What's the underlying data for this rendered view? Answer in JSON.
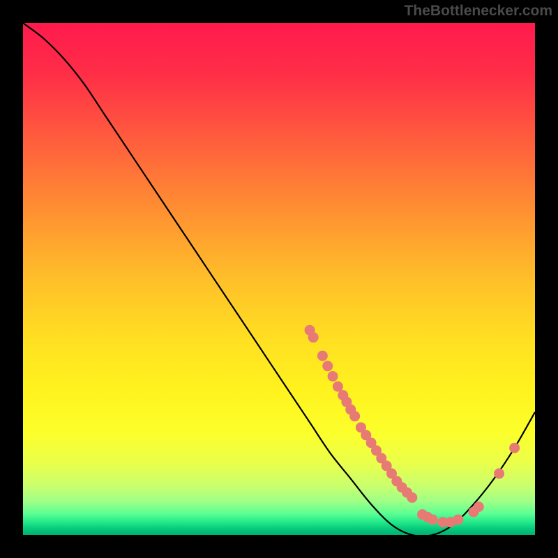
{
  "attribution": "TheBottlenecker.com",
  "chart_data": {
    "type": "line",
    "title": "",
    "xlabel": "",
    "ylabel": "",
    "xlim": [
      0,
      100
    ],
    "ylim": [
      0,
      100
    ],
    "series": [
      {
        "name": "curve",
        "x": [
          0,
          4,
          8,
          12,
          16,
          20,
          24,
          28,
          32,
          36,
          40,
          44,
          48,
          52,
          56,
          60,
          64,
          68,
          72,
          76,
          80,
          84,
          88,
          92,
          96,
          100
        ],
        "y": [
          100,
          97,
          93,
          88,
          82,
          76,
          70,
          64,
          58,
          52,
          46,
          40,
          34,
          28,
          22,
          16,
          11,
          6,
          2,
          0,
          0,
          2,
          6,
          11,
          17,
          24
        ]
      }
    ],
    "scatter_points": [
      {
        "x": 56,
        "y": 40
      },
      {
        "x": 56.7,
        "y": 38.6
      },
      {
        "x": 58.5,
        "y": 35
      },
      {
        "x": 59.5,
        "y": 33
      },
      {
        "x": 60.5,
        "y": 31
      },
      {
        "x": 61.5,
        "y": 29
      },
      {
        "x": 62.5,
        "y": 27.3
      },
      {
        "x": 63.2,
        "y": 26
      },
      {
        "x": 64,
        "y": 24.5
      },
      {
        "x": 64.8,
        "y": 23.2
      },
      {
        "x": 66,
        "y": 21
      },
      {
        "x": 67,
        "y": 19.5
      },
      {
        "x": 68,
        "y": 18
      },
      {
        "x": 69,
        "y": 16.5
      },
      {
        "x": 70,
        "y": 15
      },
      {
        "x": 71,
        "y": 13.5
      },
      {
        "x": 72,
        "y": 12
      },
      {
        "x": 73,
        "y": 10.5
      },
      {
        "x": 74,
        "y": 9.3
      },
      {
        "x": 75,
        "y": 8.3
      },
      {
        "x": 76,
        "y": 7.3
      },
      {
        "x": 78,
        "y": 4
      },
      {
        "x": 79,
        "y": 3.5
      },
      {
        "x": 80,
        "y": 3
      },
      {
        "x": 82,
        "y": 2.5
      },
      {
        "x": 83.5,
        "y": 2.5
      },
      {
        "x": 85,
        "y": 3
      },
      {
        "x": 88,
        "y": 4.5
      },
      {
        "x": 89,
        "y": 5.5
      },
      {
        "x": 93,
        "y": 12
      },
      {
        "x": 96,
        "y": 17
      }
    ],
    "gradient_stops": [
      {
        "offset": 0.0,
        "color": "#ff1a4d"
      },
      {
        "offset": 0.1,
        "color": "#ff2e47"
      },
      {
        "offset": 0.22,
        "color": "#ff5a3e"
      },
      {
        "offset": 0.35,
        "color": "#ff8a33"
      },
      {
        "offset": 0.5,
        "color": "#ffbf29"
      },
      {
        "offset": 0.62,
        "color": "#ffe022"
      },
      {
        "offset": 0.72,
        "color": "#fff31e"
      },
      {
        "offset": 0.8,
        "color": "#fcff2b"
      },
      {
        "offset": 0.86,
        "color": "#eaff4a"
      },
      {
        "offset": 0.905,
        "color": "#c8ff6e"
      },
      {
        "offset": 0.935,
        "color": "#9cff86"
      },
      {
        "offset": 0.958,
        "color": "#5dff93"
      },
      {
        "offset": 0.975,
        "color": "#22e98a"
      },
      {
        "offset": 0.988,
        "color": "#06c97b"
      },
      {
        "offset": 1.0,
        "color": "#00b072"
      }
    ],
    "marker_color": "#e77a74",
    "line_color": "#000000"
  }
}
